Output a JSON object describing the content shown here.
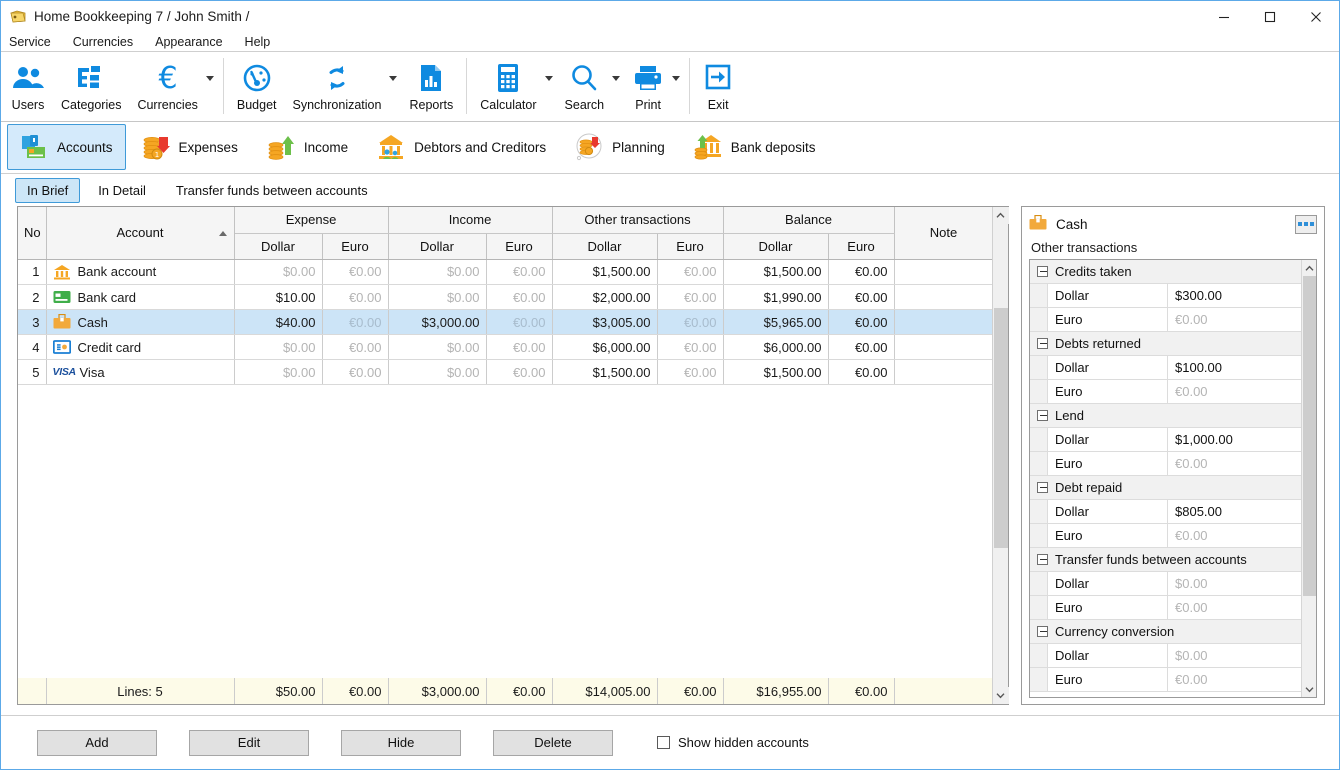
{
  "window": {
    "title": "Home Bookkeeping 7  / John Smith /",
    "app_icon": "folder-icon",
    "minimize": "minimize-icon",
    "maximize": "maximize-icon",
    "close": "close-icon"
  },
  "menu": {
    "items": [
      {
        "label": "Service"
      },
      {
        "label": "Currencies"
      },
      {
        "label": "Appearance"
      },
      {
        "label": "Help"
      }
    ]
  },
  "toolbar": {
    "accent": "#0f8ae0",
    "groups": [
      {
        "items": [
          {
            "label": "Users",
            "icon": "users-icon",
            "dropdown": false
          },
          {
            "label": "Categories",
            "icon": "categories-icon",
            "dropdown": false
          },
          {
            "label": "Currencies",
            "icon": "euro-icon",
            "dropdown": true
          }
        ]
      },
      {
        "items": [
          {
            "label": "Budget",
            "icon": "gauge-icon",
            "dropdown": false
          },
          {
            "label": "Synchronization",
            "icon": "sync-icon",
            "dropdown": true
          },
          {
            "label": "Reports",
            "icon": "reports-icon",
            "dropdown": false
          }
        ]
      },
      {
        "items": [
          {
            "label": "Calculator",
            "icon": "calculator-icon",
            "dropdown": true
          },
          {
            "label": "Search",
            "icon": "search-icon",
            "dropdown": true
          },
          {
            "label": "Print",
            "icon": "print-icon",
            "dropdown": true
          }
        ]
      },
      {
        "items": [
          {
            "label": "Exit",
            "icon": "exit-icon",
            "dropdown": false
          }
        ]
      }
    ]
  },
  "sections": [
    {
      "label": "Accounts",
      "icon": "accounts-icon",
      "active": true
    },
    {
      "label": "Expenses",
      "icon": "expenses-icon",
      "active": false
    },
    {
      "label": "Income",
      "icon": "income-icon",
      "active": false
    },
    {
      "label": "Debtors and Creditors",
      "icon": "debtors-icon",
      "active": false
    },
    {
      "label": "Planning",
      "icon": "planning-icon",
      "active": false
    },
    {
      "label": "Bank deposits",
      "icon": "bank-deposits-icon",
      "active": false
    }
  ],
  "subtabs": [
    {
      "label": "In Brief",
      "active": true
    },
    {
      "label": "In Detail",
      "active": false
    },
    {
      "label": "Transfer funds between accounts",
      "active": false
    }
  ],
  "grid": {
    "group_headers": [
      {
        "label": "No"
      },
      {
        "label": "Account",
        "sorted": true
      },
      {
        "label": "Expense"
      },
      {
        "label": "Income"
      },
      {
        "label": "Other transactions"
      },
      {
        "label": "Balance"
      },
      {
        "label": "Note"
      }
    ],
    "currency_headers": [
      "Dollar",
      "Euro",
      "Dollar",
      "Euro",
      "Dollar",
      "Euro",
      "Dollar",
      "Euro"
    ],
    "rows": [
      {
        "no": "1",
        "account": "Bank account",
        "icon": "bank-account-icon",
        "selected": false,
        "expense_dollar": "$0.00",
        "expense_dollar_zero": true,
        "expense_euro": "€0.00",
        "expense_euro_zero": true,
        "income_dollar": "$0.00",
        "income_dollar_zero": true,
        "income_euro": "€0.00",
        "income_euro_zero": true,
        "other_dollar": "$1,500.00",
        "other_dollar_zero": false,
        "other_euro": "€0.00",
        "other_euro_zero": true,
        "balance_dollar": "$1,500.00",
        "balance_dollar_zero": false,
        "balance_euro": "€0.00",
        "balance_euro_zero": false,
        "note": ""
      },
      {
        "no": "2",
        "account": "Bank card",
        "icon": "bank-card-icon",
        "selected": false,
        "expense_dollar": "$10.00",
        "expense_dollar_zero": false,
        "expense_euro": "€0.00",
        "expense_euro_zero": true,
        "income_dollar": "$0.00",
        "income_dollar_zero": true,
        "income_euro": "€0.00",
        "income_euro_zero": true,
        "other_dollar": "$2,000.00",
        "other_dollar_zero": false,
        "other_euro": "€0.00",
        "other_euro_zero": true,
        "balance_dollar": "$1,990.00",
        "balance_dollar_zero": false,
        "balance_euro": "€0.00",
        "balance_euro_zero": false,
        "note": ""
      },
      {
        "no": "3",
        "account": "Cash",
        "icon": "cash-icon",
        "selected": true,
        "expense_dollar": "$40.00",
        "expense_dollar_zero": false,
        "expense_euro": "€0.00",
        "expense_euro_zero": true,
        "income_dollar": "$3,000.00",
        "income_dollar_zero": false,
        "income_euro": "€0.00",
        "income_euro_zero": true,
        "other_dollar": "$3,005.00",
        "other_dollar_zero": false,
        "other_euro": "€0.00",
        "other_euro_zero": true,
        "balance_dollar": "$5,965.00",
        "balance_dollar_zero": false,
        "balance_euro": "€0.00",
        "balance_euro_zero": false,
        "note": ""
      },
      {
        "no": "4",
        "account": "Credit card",
        "icon": "credit-card-icon",
        "selected": false,
        "expense_dollar": "$0.00",
        "expense_dollar_zero": true,
        "expense_euro": "€0.00",
        "expense_euro_zero": true,
        "income_dollar": "$0.00",
        "income_dollar_zero": true,
        "income_euro": "€0.00",
        "income_euro_zero": true,
        "other_dollar": "$6,000.00",
        "other_dollar_zero": false,
        "other_euro": "€0.00",
        "other_euro_zero": true,
        "balance_dollar": "$6,000.00",
        "balance_dollar_zero": false,
        "balance_euro": "€0.00",
        "balance_euro_zero": false,
        "note": ""
      },
      {
        "no": "5",
        "account": "Visa",
        "icon": "visa-icon",
        "selected": false,
        "expense_dollar": "$0.00",
        "expense_dollar_zero": true,
        "expense_euro": "€0.00",
        "expense_euro_zero": true,
        "income_dollar": "$0.00",
        "income_dollar_zero": true,
        "income_euro": "€0.00",
        "income_euro_zero": true,
        "other_dollar": "$1,500.00",
        "other_dollar_zero": false,
        "other_euro": "€0.00",
        "other_euro_zero": true,
        "balance_dollar": "$1,500.00",
        "balance_dollar_zero": false,
        "balance_euro": "€0.00",
        "balance_euro_zero": false,
        "note": ""
      }
    ],
    "footer": {
      "lines": "Lines: 5",
      "expense_dollar": "$50.00",
      "expense_euro": "€0.00",
      "income_dollar": "$3,000.00",
      "income_euro": "€0.00",
      "other_dollar": "$14,005.00",
      "other_euro": "€0.00",
      "balance_dollar": "$16,955.00",
      "balance_euro": "€0.00",
      "note": ""
    }
  },
  "sidepanel": {
    "title": "Cash",
    "icon": "cash-icon",
    "more_button": "more-options-icon",
    "subtitle": "Other transactions",
    "groups": [
      {
        "label": "Credits taken",
        "rows": [
          {
            "currency": "Dollar",
            "value": "$300.00",
            "zero": false
          },
          {
            "currency": "Euro",
            "value": "€0.00",
            "zero": true
          }
        ]
      },
      {
        "label": "Debts returned",
        "rows": [
          {
            "currency": "Dollar",
            "value": "$100.00",
            "zero": false
          },
          {
            "currency": "Euro",
            "value": "€0.00",
            "zero": true
          }
        ]
      },
      {
        "label": "Lend",
        "rows": [
          {
            "currency": "Dollar",
            "value": "$1,000.00",
            "zero": false
          },
          {
            "currency": "Euro",
            "value": "€0.00",
            "zero": true
          }
        ]
      },
      {
        "label": "Debt repaid",
        "rows": [
          {
            "currency": "Dollar",
            "value": "$805.00",
            "zero": false
          },
          {
            "currency": "Euro",
            "value": "€0.00",
            "zero": true
          }
        ]
      },
      {
        "label": "Transfer funds between accounts",
        "rows": [
          {
            "currency": "Dollar",
            "value": "$0.00",
            "zero": true
          },
          {
            "currency": "Euro",
            "value": "€0.00",
            "zero": true
          }
        ]
      },
      {
        "label": "Currency conversion",
        "rows": [
          {
            "currency": "Dollar",
            "value": "$0.00",
            "zero": true
          },
          {
            "currency": "Euro",
            "value": "€0.00",
            "zero": true
          }
        ]
      }
    ]
  },
  "bottombar": {
    "buttons": [
      {
        "label": "Add"
      },
      {
        "label": "Edit"
      },
      {
        "label": "Hide"
      },
      {
        "label": "Delete"
      }
    ],
    "checkbox": {
      "label": "Show hidden accounts",
      "checked": false
    }
  }
}
